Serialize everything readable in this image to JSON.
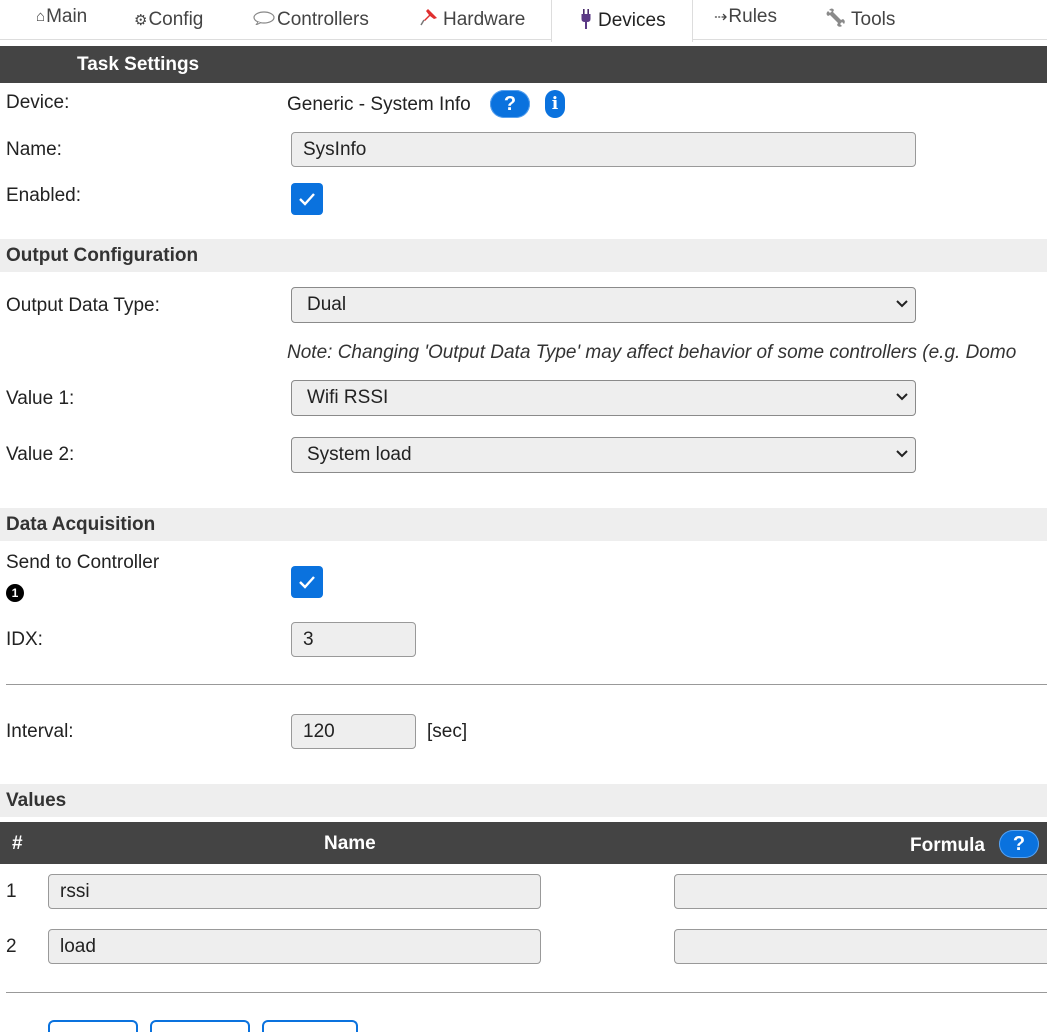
{
  "tabs": [
    {
      "icon": "⌂",
      "label": "Main"
    },
    {
      "icon": "⚙",
      "label": "Config"
    },
    {
      "icon": "💬",
      "label": "Controllers"
    },
    {
      "icon": "📌",
      "label": "Hardware"
    },
    {
      "icon": "🔌",
      "label": "Devices"
    },
    {
      "icon": "⇢",
      "label": "Rules"
    },
    {
      "icon": "🔧",
      "label": "Tools"
    }
  ],
  "task_settings": {
    "title": "Task Settings",
    "device_label": "Device:",
    "device_value": "Generic - System Info",
    "help_glyph": "?",
    "info_glyph": "i",
    "name_label": "Name:",
    "name_value": "SysInfo",
    "enabled_label": "Enabled:",
    "enabled_checked": true
  },
  "output_config": {
    "title": "Output Configuration",
    "output_type_label": "Output Data Type:",
    "output_type_value": "Dual",
    "note": "Note: Changing 'Output Data Type' may affect behavior of some controllers (e.g. Domo",
    "value1_label": "Value 1:",
    "value1_value": "Wifi RSSI",
    "value2_label": "Value 2:",
    "value2_value": "System load"
  },
  "data_acquisition": {
    "title": "Data Acquisition",
    "send_label": "Send to Controller",
    "controller_number": "1",
    "send_checked": true,
    "idx_label": "IDX:",
    "idx_value": "3",
    "interval_label": "Interval:",
    "interval_value": "120",
    "interval_unit": "[sec]"
  },
  "values": {
    "title": "Values",
    "col_num": "#",
    "col_name": "Name",
    "col_formula": "Formula",
    "rows": [
      {
        "num": "1",
        "name": "rssi",
        "formula": ""
      },
      {
        "num": "2",
        "name": "load",
        "formula": ""
      }
    ]
  },
  "colors": {
    "accent": "#0a72de",
    "header_bg": "#444444",
    "section_bg": "#eeeeee"
  }
}
